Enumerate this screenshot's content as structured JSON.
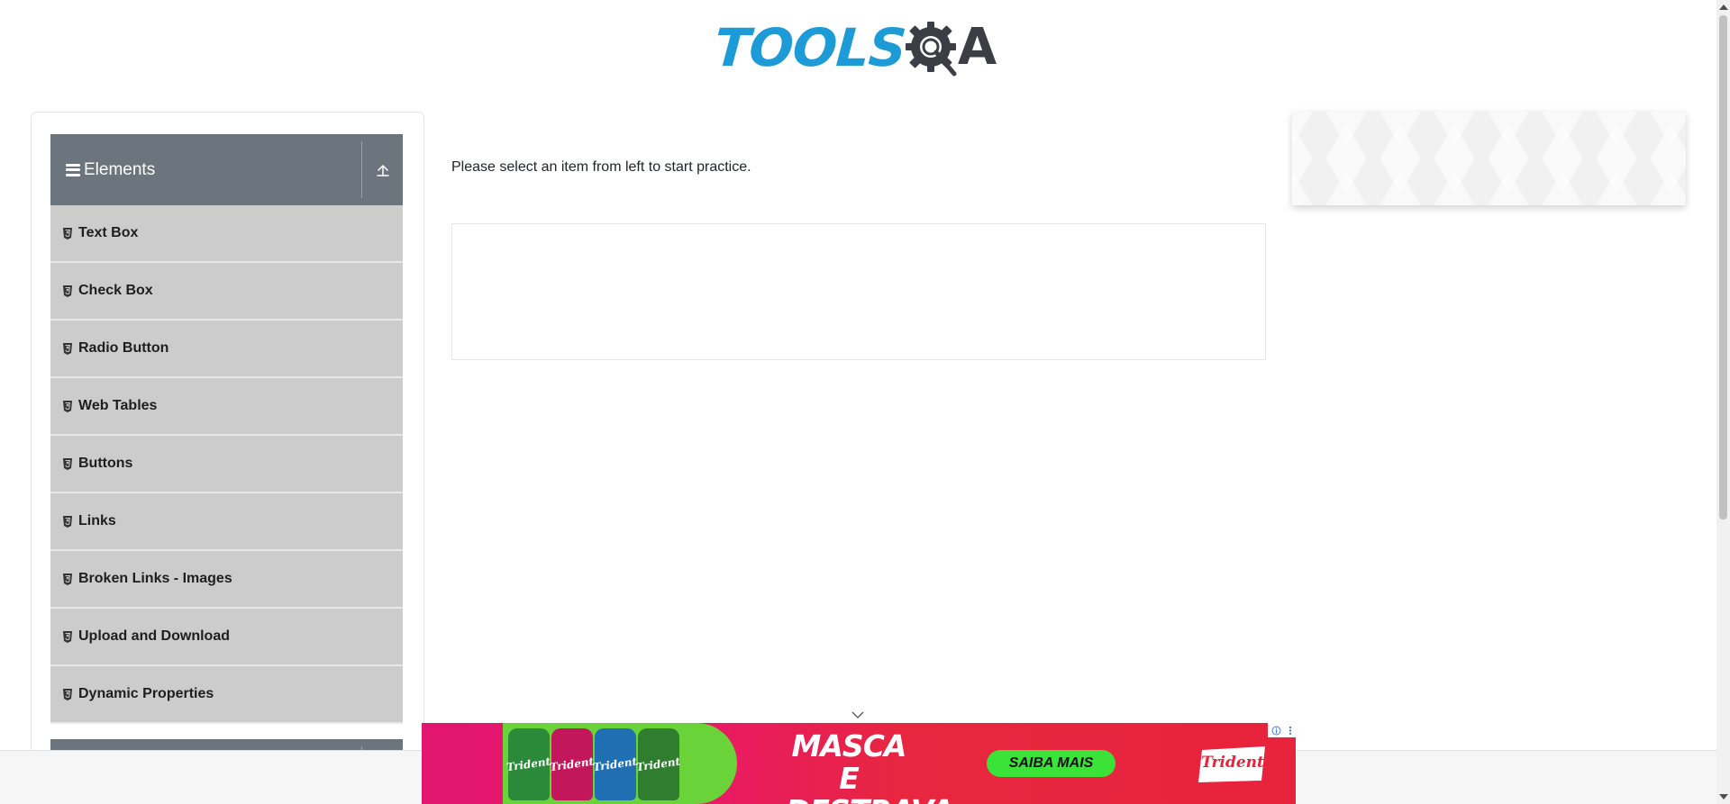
{
  "header": {
    "logo_text_tools": "TOOLS",
    "logo_text_a": "A",
    "logo_icon": "gear-magnifier-icon",
    "logo_colors": {
      "tools": "#1c9bd6",
      "qa": "#3b3f45"
    }
  },
  "sidebar": {
    "group": {
      "title": "Elements",
      "menu_icon": "hamburger-icon",
      "toggle_icon": "collapse-up-icon",
      "header_color": "#6c757d"
    },
    "item_icon": "html5-icon",
    "item_color": "#cccccc",
    "items": [
      {
        "label": "Text Box"
      },
      {
        "label": "Check Box"
      },
      {
        "label": "Radio Button"
      },
      {
        "label": "Web Tables"
      },
      {
        "label": "Buttons"
      },
      {
        "label": "Links"
      },
      {
        "label": "Broken Links - Images"
      },
      {
        "label": "Upload and Download"
      },
      {
        "label": "Dynamic Properties"
      }
    ]
  },
  "main": {
    "instruction": "Please select an item from left to start practice."
  },
  "banner_ad": {
    "brand_pack_text": "Trident",
    "slogan": "MASCA E DESTRAVA",
    "cta_label": "SAIBA MAIS",
    "brand_logo": "Trident",
    "adchoices_icon": "info-icon",
    "menu_icon": "kebab-icon",
    "toggle_icon": "chevron-down-icon",
    "colors": {
      "pink": "#e2166f",
      "red": "#e8243c",
      "green": "#3be237"
    }
  }
}
